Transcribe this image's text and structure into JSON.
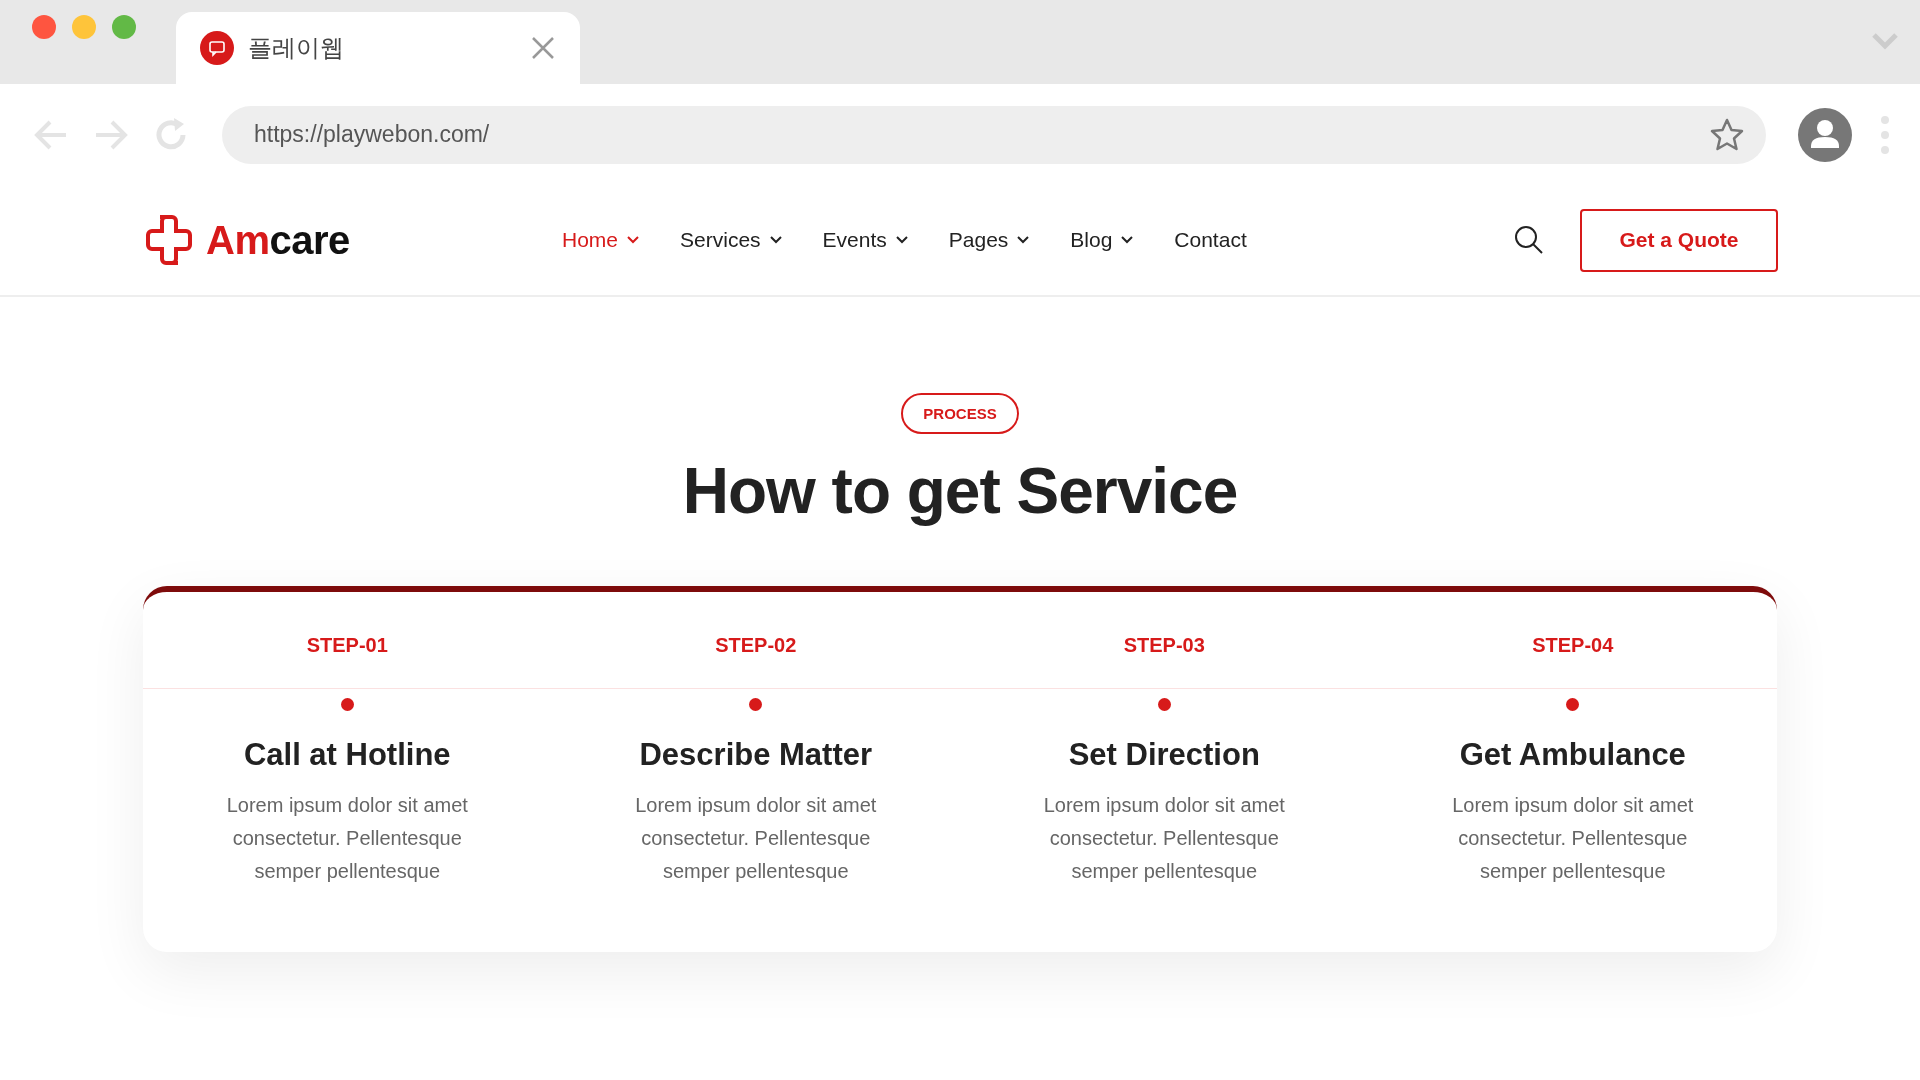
{
  "browser": {
    "tab": {
      "title": "플레이웹"
    },
    "url": "https://playwebon.com/"
  },
  "header": {
    "logo": "Amcare",
    "nav": [
      {
        "label": "Home",
        "dropdown": true,
        "selected": true
      },
      {
        "label": "Services",
        "dropdown": true,
        "selected": false
      },
      {
        "label": "Events",
        "dropdown": true,
        "selected": false
      },
      {
        "label": "Pages",
        "dropdown": true,
        "selected": false
      },
      {
        "label": "Blog",
        "dropdown": true,
        "selected": false
      },
      {
        "label": "Contact",
        "dropdown": false,
        "selected": false
      }
    ],
    "cta": "Get a Quote"
  },
  "section": {
    "badge": "PROCESS",
    "title": "How to get Service",
    "steps": [
      {
        "step": "STEP-01",
        "title": "Call at Hotline",
        "text": "Lorem ipsum dolor sit amet consectetur. Pellentesque semper pellentesque"
      },
      {
        "step": "STEP-02",
        "title": "Describe Matter",
        "text": "Lorem ipsum dolor sit amet consectetur. Pellentesque semper pellentesque"
      },
      {
        "step": "STEP-03",
        "title": "Set Direction",
        "text": "Lorem ipsum dolor sit amet consectetur. Pellentesque semper pellentesque"
      },
      {
        "step": "STEP-04",
        "title": "Get Ambulance",
        "text": "Lorem ipsum dolor sit amet consectetur. Pellentesque semper pellentesque"
      }
    ]
  }
}
